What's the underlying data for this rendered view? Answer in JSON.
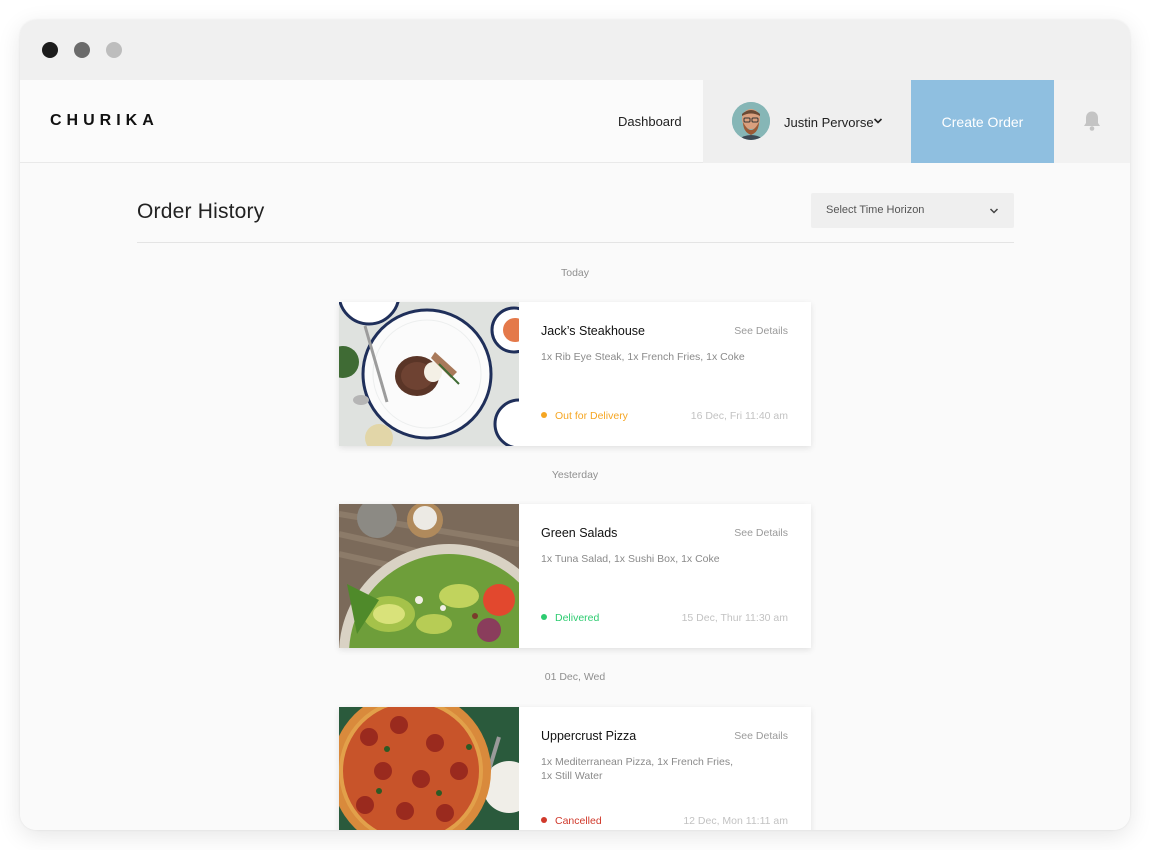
{
  "app": {
    "logo": "CHURIKA"
  },
  "nav": {
    "dashboard_label": "Dashboard",
    "user_name": "Justin Pervorse",
    "create_order_label": "Create Order"
  },
  "page": {
    "title": "Order History",
    "time_horizon_placeholder": "Select Time Horizon"
  },
  "colors": {
    "accent": "#8fbfe0",
    "out_for_delivery": "#f5a623",
    "delivered": "#2ecc71",
    "cancelled": "#d0392b"
  },
  "groups": [
    {
      "label": "Today",
      "order": {
        "restaurant": "Jack’s Steakhouse",
        "details_label": "See Details",
        "items": "1x Rib Eye Steak, 1x French Fries, 1x Coke",
        "status": "Out for Delivery",
        "time": "16 Dec, Fri 11:40 am",
        "image": "steak-plate"
      }
    },
    {
      "label": "Yesterday",
      "order": {
        "restaurant": "Green Salads",
        "details_label": "See Details",
        "items": "1x Tuna Salad, 1x Sushi Box, 1x Coke",
        "status": "Delivered",
        "time": "15 Dec, Thur 11:30 am",
        "image": "salad-bowl"
      }
    },
    {
      "label": "01 Dec, Wed",
      "order": {
        "restaurant": "Uppercrust Pizza",
        "details_label": "See Details",
        "items": "1x Mediterranean Pizza, 1x French Fries, 1x Still Water",
        "status": "Cancelled",
        "time": "12 Dec,  Mon 11:11 am",
        "image": "pizza"
      }
    }
  ]
}
